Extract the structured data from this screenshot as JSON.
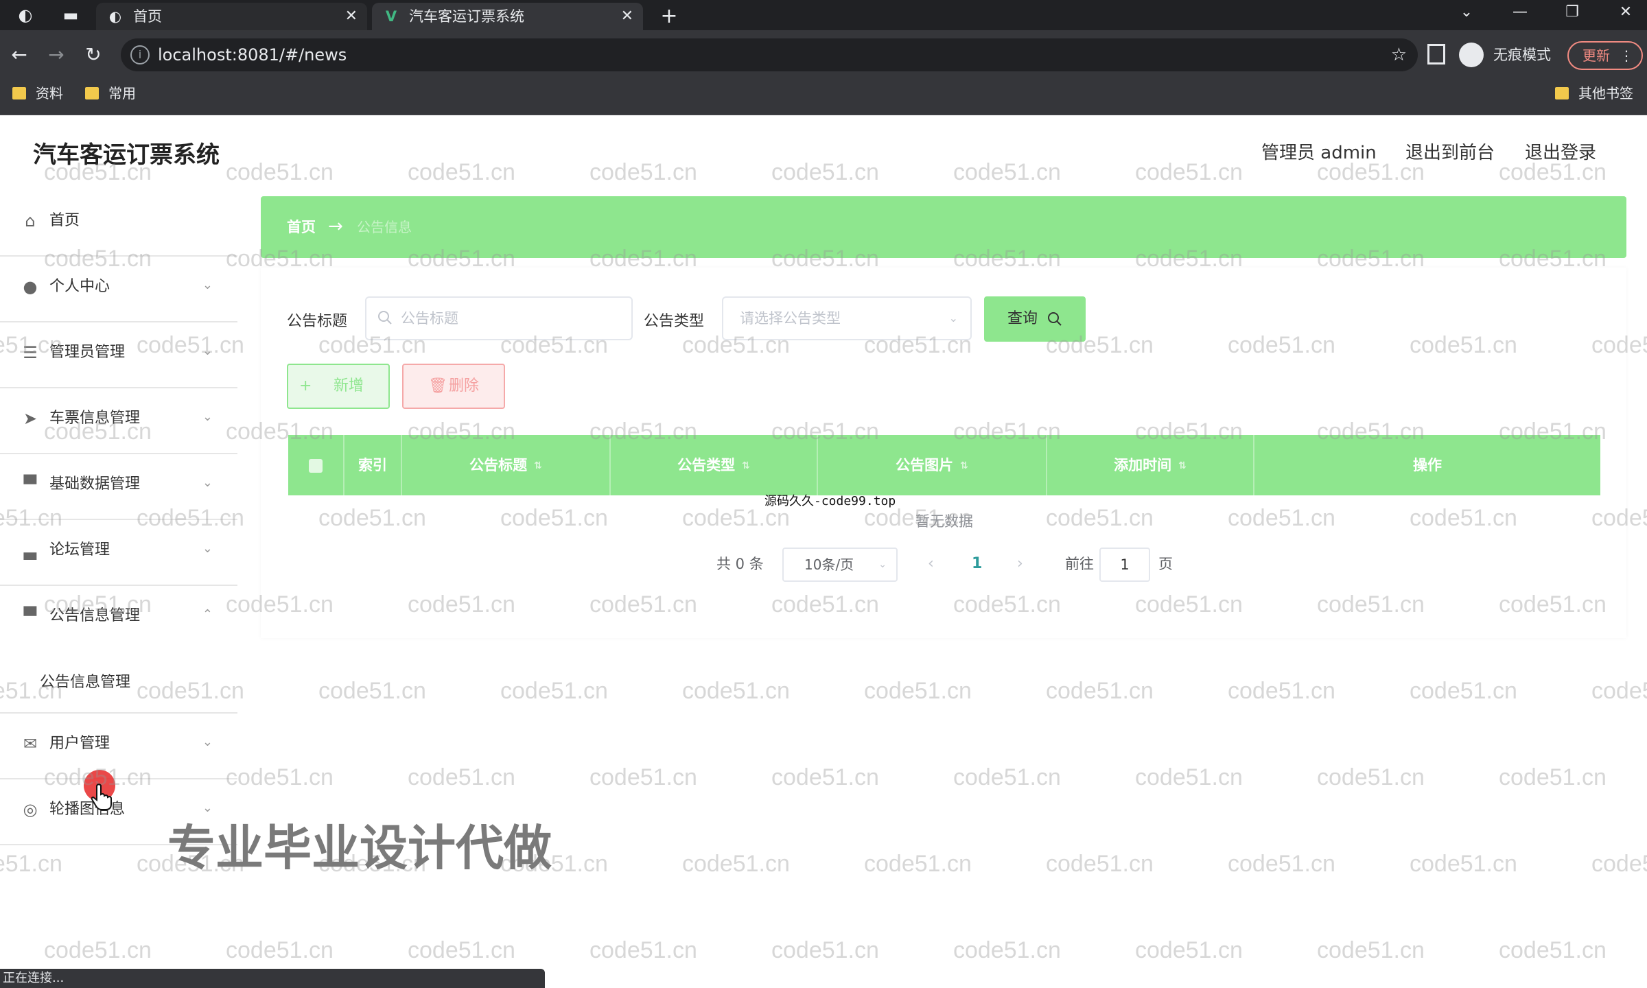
{
  "browser": {
    "tabs": [
      {
        "title": "首页",
        "favicon": "globe-icon"
      },
      {
        "title": "汽车客运订票系统",
        "favicon": "vue-logo-icon"
      }
    ],
    "new_tab": "+",
    "url": "localhost:8081/#/news",
    "incognito_label": "无痕模式",
    "update_label": "更新",
    "bookmarks": [
      "资料",
      "常用"
    ],
    "other_bookmarks": "其他书签",
    "status_text": "正在连接..."
  },
  "app": {
    "title": "汽车客运订票系统",
    "admin_label": "管理员 admin",
    "front_link": "退出到前台",
    "logout_link": "退出登录"
  },
  "sidebar": {
    "items": [
      {
        "label": "首页",
        "icon": "home-icon"
      },
      {
        "label": "个人中心",
        "icon": "user-icon"
      },
      {
        "label": "管理员管理",
        "icon": "list-icon"
      },
      {
        "label": "车票信息管理",
        "icon": "send-icon"
      },
      {
        "label": "基础数据管理",
        "icon": "monitor-icon"
      },
      {
        "label": "论坛管理",
        "icon": "briefcase-icon"
      },
      {
        "label": "公告信息管理",
        "icon": "monitor-icon"
      },
      {
        "label": "公告信息管理",
        "icon": "none"
      },
      {
        "label": "用户管理",
        "icon": "mail-icon"
      },
      {
        "label": "轮播图信息",
        "icon": "compass-icon"
      }
    ]
  },
  "breadcrumb": {
    "home": "首页",
    "separator": "→",
    "current": "公告信息"
  },
  "search": {
    "title_label": "公告标题",
    "title_placeholder": "公告标题",
    "type_label": "公告类型",
    "type_placeholder": "请选择公告类型",
    "query_button": "查询"
  },
  "actions": {
    "add": "新增",
    "delete": "删除"
  },
  "table": {
    "headers": [
      "索引",
      "公告标题",
      "公告类型",
      "公告图片",
      "添加时间",
      "操作"
    ],
    "empty_text": "暂无数据"
  },
  "pagination": {
    "total": "共 0 条",
    "page_size": "10条/页",
    "current_page": "1",
    "goto_label": "前往",
    "goto_value": "1",
    "page_suffix": "页"
  },
  "overlays": {
    "stamp": "源码久久-code99.top",
    "watermark_text": "code51.cn",
    "ad_text": "专业毕业设计代做"
  },
  "colors": {
    "accent_green": "#8ee68e",
    "danger_red": "#f5a9a9",
    "page_link": "#2d9b9b"
  }
}
